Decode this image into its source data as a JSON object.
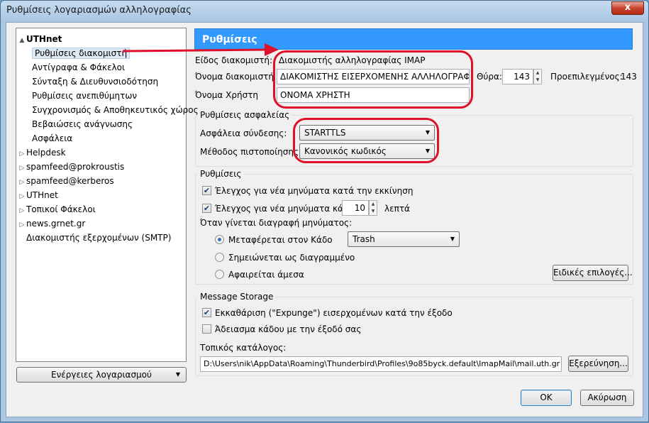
{
  "window": {
    "title": "Ρυθμίσεις λογαριασμών αλληλογραφίας",
    "close_label": "x"
  },
  "tree": {
    "items": [
      {
        "label": "UTHnet",
        "level": 0,
        "expander": "▲",
        "bold": true
      },
      {
        "label": "Ρυθμίσεις διακομιστή",
        "level": 1,
        "selected": true
      },
      {
        "label": "Αντίγραφα & Φάκελοι",
        "level": 1
      },
      {
        "label": "Σύνταξη & Διευθυνσιοδότηση",
        "level": 1
      },
      {
        "label": "Ρυθμίσεις ανεπιθύμητων",
        "level": 1
      },
      {
        "label": "Συγχρονισμός & Αποθηκευτικός χώρος",
        "level": 1
      },
      {
        "label": "Βεβαιώσεις ανάγνωσης",
        "level": 1
      },
      {
        "label": "Ασφάλεια",
        "level": 1
      },
      {
        "label": "Helpdesk",
        "level": 0,
        "expander": "▷"
      },
      {
        "label": "spamfeed@prokroustis",
        "level": 0,
        "expander": "▷"
      },
      {
        "label": "spamfeed@kerberos",
        "level": 0,
        "expander": "▷"
      },
      {
        "label": "UTHnet",
        "level": 0,
        "expander": "▷"
      },
      {
        "label": "Τοπικοί Φάκελοι",
        "level": 0,
        "expander": "▷"
      },
      {
        "label": "news.grnet.gr",
        "level": 0,
        "expander": "▷"
      },
      {
        "label": "Διακομιστής εξερχομένων (SMTP)",
        "level": 0
      }
    ],
    "account_actions": "Ενέργειες λογαριασμού",
    "account_actions_arrow": "▼"
  },
  "main": {
    "header": "Ρυθμίσεις",
    "server_type_label": "Είδος διακομιστή:",
    "server_type_value": "Διακομιστής αλληλογραφίας IMAP",
    "server_name_label": "Όνομα διακομιστή :",
    "server_name_value": "ΔΙΑΚΟΜΙΣΤΗΣ ΕΙΣΕΡΧΟΜΕΝΗΣ ΑΛΛΗΛΟΓΡΑΦΙΑΣ",
    "port_label": "Θύρα:",
    "port_value": "143",
    "default_label": "Προεπιλεγμένος:",
    "default_value": "143",
    "username_label": "Όνομα Χρήστη",
    "username_value": "ΟΝΟΜΑ ΧΡΗΣΤΗ"
  },
  "security": {
    "title": "Ρυθμίσεις ασφαλείας",
    "connection_label": "Ασφάλεια σύνδεσης:",
    "connection_value": "STARTTLS",
    "auth_label": "Μέθοδος πιστοποίησης:",
    "auth_value": "Κανονικός κωδικός"
  },
  "settings": {
    "title": "Ρυθμίσεις",
    "check_startup": "Έλεγχος για νέα μηνύματα κατά την εκκίνηση",
    "check_every": "Έλεγχος για νέα μηνύματα κάθε",
    "minutes_value": "10",
    "minutes_label": "λεπτά",
    "on_delete_label": "Όταν γίνεται διαγραφή μηνύματος:",
    "move_trash": "Μεταφέρεται στον Κάδο",
    "trash_folder": "Trash",
    "mark_deleted": "Σημειώνεται ως διαγραμμένο",
    "remove_immediately": "Αφαιρείται άμεσα",
    "advanced_button": "Ειδικές επιλογές..."
  },
  "storage": {
    "title": "Message Storage",
    "expunge": "Εκκαθάριση (\"Expunge\") εισερχομένων κατά την έξοδο",
    "empty_trash": "Άδειασμα κάδου με την έξοδό σας",
    "local_dir_label": "Τοπικός κατάλογος:",
    "local_dir_value": "D:\\Users\\nik\\AppData\\Roaming\\Thunderbird\\Profiles\\9o85byck.default\\ImapMail\\mail.uth.gr",
    "browse_button": "Εξερεύνηση..."
  },
  "footer": {
    "ok": "OK",
    "cancel": "Ακύρωση"
  },
  "colors": {
    "header": "#3399ff",
    "annotation": "#e0102a",
    "selected": "#dde8f3"
  },
  "icons": {
    "check": "✔",
    "spin_up": "▲",
    "spin_down": "▼",
    "dropdown": "▼"
  }
}
